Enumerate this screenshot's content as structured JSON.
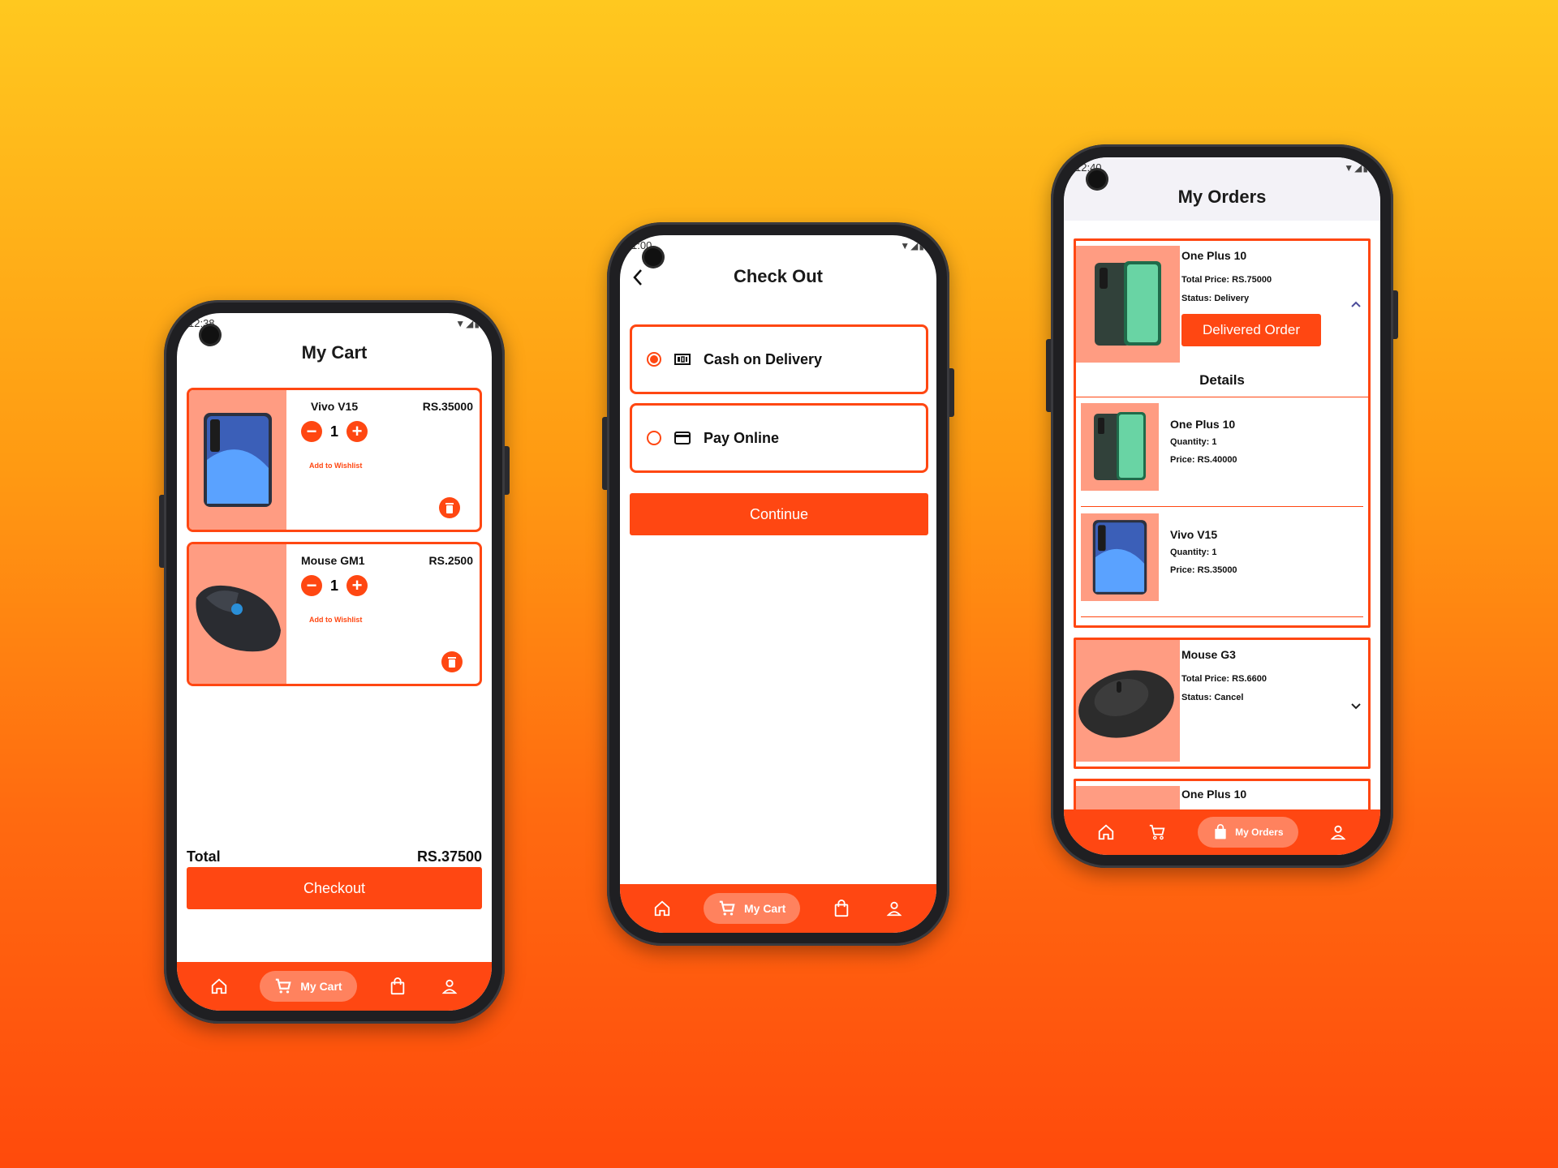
{
  "screens": {
    "cart": {
      "time": "12:38",
      "title": "My Cart",
      "items": [
        {
          "name": "Vivo V15",
          "price": "RS.35000",
          "qty": "1",
          "wishlist": "Add to Wishlist"
        },
        {
          "name": "Mouse GM1",
          "price": "RS.2500",
          "qty": "1",
          "wishlist": "Add to Wishlist"
        }
      ],
      "total_label": "Total",
      "total_value": "RS.37500",
      "checkout_label": "Checkout",
      "nav_active": "My Cart"
    },
    "checkout": {
      "time": "1:00",
      "title": "Check Out",
      "options": [
        {
          "label": "Cash on Delivery",
          "selected": true
        },
        {
          "label": "Pay Online",
          "selected": false
        }
      ],
      "continue_label": "Continue",
      "nav_active": "My Cart"
    },
    "orders": {
      "time": "12:40",
      "title": "My Orders",
      "orders": [
        {
          "name": "One Plus 10",
          "total": "Total Price: RS.75000",
          "status": "Status: Delivery",
          "action": "Delivered Order",
          "details_label": "Details",
          "details": [
            {
              "name": "One Plus 10",
              "qty": "Quantity: 1",
              "price": "Price: RS.40000"
            },
            {
              "name": "Vivo V15",
              "qty": "Quantity: 1",
              "price": "Price: RS.35000"
            }
          ]
        },
        {
          "name": "Mouse G3",
          "total": "Total Price: RS.6600",
          "status": "Status: Cancel"
        },
        {
          "name": "One Plus 10"
        }
      ],
      "nav_active": "My Orders"
    }
  },
  "colors": {
    "accent": "#FF4712",
    "thumb_bg": "#FF9C82",
    "nav_bg": "#FF4712"
  },
  "icons": [
    "home-icon",
    "cart-icon",
    "bag-icon",
    "user-icon",
    "trash-icon",
    "cash-icon",
    "card-icon",
    "back-arrow-icon",
    "chevron-up-icon",
    "chevron-down-icon",
    "wifi-icon",
    "signal-icon",
    "battery-icon"
  ]
}
